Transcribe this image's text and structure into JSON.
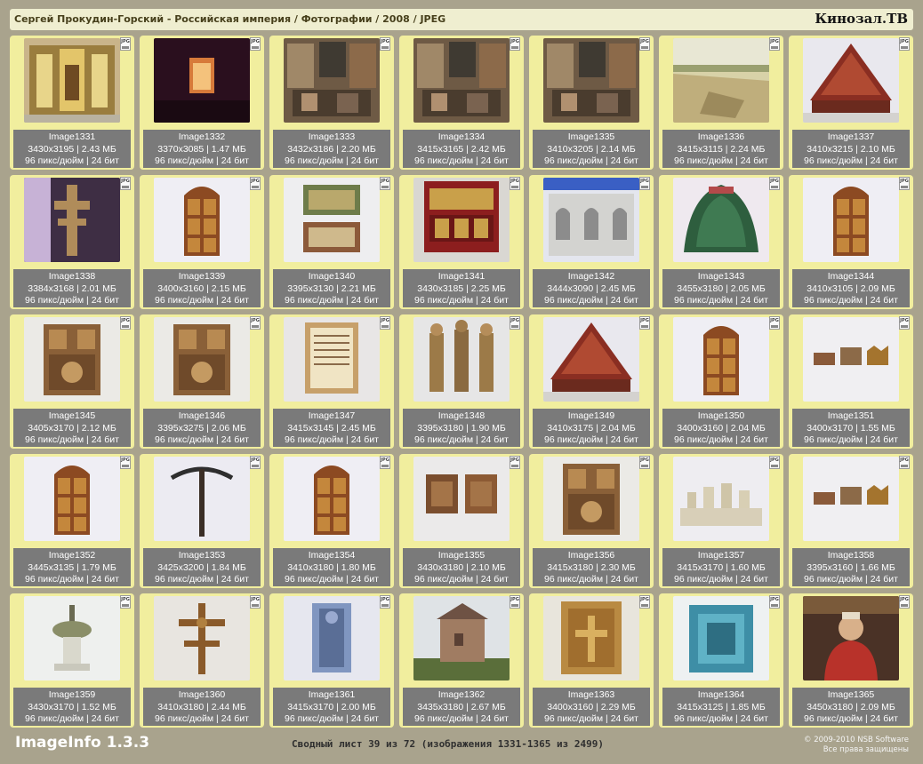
{
  "header": {
    "path_title": "Сергей Прокудин-Горский - Российская империя / Фотографии / 2008 / JPEG",
    "site_name": "Кинозал.ТВ"
  },
  "file_badge": "JPG",
  "images": [
    {
      "name": "Image1331",
      "size": "3430x3195 | 2.43 МБ",
      "meta": "96 пикс/дюйм | 24 бит",
      "scene": "iconostasis"
    },
    {
      "name": "Image1332",
      "size": "3370x3085 | 1.47 МБ",
      "meta": "96 пикс/дюйм | 24 бит",
      "scene": "dark-door"
    },
    {
      "name": "Image1333",
      "size": "3432x3186 | 2.20 МБ",
      "meta": "96 пикс/дюйм | 24 бит",
      "scene": "interior"
    },
    {
      "name": "Image1334",
      "size": "3415x3165 | 2.42 МБ",
      "meta": "96 пикс/дюйм | 24 бит",
      "scene": "interior"
    },
    {
      "name": "Image1335",
      "size": "3410x3205 | 2.14 МБ",
      "meta": "96 пикс/дюйм | 24 бит",
      "scene": "interior"
    },
    {
      "name": "Image1336",
      "size": "3415x3115 | 2.24 МБ",
      "meta": "96 пикс/дюйм | 24 бит",
      "scene": "landscape"
    },
    {
      "name": "Image1337",
      "size": "3410x3215 | 2.10 МБ",
      "meta": "96 пикс/дюйм | 24 бит",
      "scene": "vestment"
    },
    {
      "name": "Image1338",
      "size": "3384x3168 | 2.01 МБ",
      "meta": "96 пикс/дюйм | 24 бит",
      "scene": "cross"
    },
    {
      "name": "Image1339",
      "size": "3400x3160 | 2.15 МБ",
      "meta": "96 пикс/дюйм | 24 бит",
      "scene": "door"
    },
    {
      "name": "Image1340",
      "size": "3395x3130 | 2.21 МБ",
      "meta": "96 пикс/дюйм | 24 бит",
      "scene": "panels"
    },
    {
      "name": "Image1341",
      "size": "3430x3185 | 2.25 МБ",
      "meta": "96 пикс/дюйм | 24 бит",
      "scene": "red-cabinet"
    },
    {
      "name": "Image1342",
      "size": "3444x3090 | 2.45 МБ",
      "meta": "96 пикс/дюйм | 24 бит",
      "scene": "church"
    },
    {
      "name": "Image1343",
      "size": "3455x3180 | 2.05 МБ",
      "meta": "96 пикс/дюйм | 24 бит",
      "scene": "green-cloak"
    },
    {
      "name": "Image1344",
      "size": "3410x3105 | 2.09 МБ",
      "meta": "96 пикс/дюйм | 24 бит",
      "scene": "door"
    },
    {
      "name": "Image1345",
      "size": "3405x3170 | 2.12 МБ",
      "meta": "96 пикс/дюйм | 24 бит",
      "scene": "carving"
    },
    {
      "name": "Image1346",
      "size": "3395x3275 | 2.06 МБ",
      "meta": "96 пикс/дюйм | 24 бит",
      "scene": "carving"
    },
    {
      "name": "Image1347",
      "size": "3415x3145 | 2.45 МБ",
      "meta": "96 пикс/дюйм | 24 бит",
      "scene": "document"
    },
    {
      "name": "Image1348",
      "size": "3395x3180 | 1.90 МБ",
      "meta": "96 пикс/дюйм | 24 бит",
      "scene": "statues"
    },
    {
      "name": "Image1349",
      "size": "3410x3175 | 2.04 МБ",
      "meta": "96 пикс/дюйм | 24 бит",
      "scene": "vestment"
    },
    {
      "name": "Image1350",
      "size": "3400x3160 | 2.04 МБ",
      "meta": "96 пикс/дюйм | 24 бит",
      "scene": "door"
    },
    {
      "name": "Image1351",
      "size": "3400x3170 | 1.55 МБ",
      "meta": "96 пикс/дюйм | 24 бит",
      "scene": "crowns"
    },
    {
      "name": "Image1352",
      "size": "3445x3135 | 1.79 МБ",
      "meta": "96 пикс/дюйм | 24 бит",
      "scene": "door"
    },
    {
      "name": "Image1353",
      "size": "3425x3200 | 1.84 МБ",
      "meta": "96 пикс/дюйм | 24 бит",
      "scene": "staff"
    },
    {
      "name": "Image1354",
      "size": "3410x3180 | 1.80 МБ",
      "meta": "96 пикс/дюйм | 24 бит",
      "scene": "door"
    },
    {
      "name": "Image1355",
      "size": "3430x3180 | 2.10 МБ",
      "meta": "96 пикс/дюйм | 24 бит",
      "scene": "two-panels"
    },
    {
      "name": "Image1356",
      "size": "3415x3180 | 2.30 МБ",
      "meta": "96 пикс/дюйм | 24 бит",
      "scene": "carving"
    },
    {
      "name": "Image1357",
      "size": "3415x3170 | 1.60 МБ",
      "meta": "96 пикс/дюйм | 24 бит",
      "scene": "vessels"
    },
    {
      "name": "Image1358",
      "size": "3395x3160 | 1.66 МБ",
      "meta": "96 пикс/дюйм | 24 бит",
      "scene": "crowns"
    },
    {
      "name": "Image1359",
      "size": "3430x3170 | 1.52 МБ",
      "meta": "96 пикс/дюйм | 24 бит",
      "scene": "font"
    },
    {
      "name": "Image1360",
      "size": "3410x3180 | 2.44 МБ",
      "meta": "96 пикс/дюйм | 24 бит",
      "scene": "ornate-cross"
    },
    {
      "name": "Image1361",
      "size": "3415x3170 | 2.00 МБ",
      "meta": "96 пикс/дюйм | 24 бит",
      "scene": "figure-panel"
    },
    {
      "name": "Image1362",
      "size": "3435x3180 | 2.67 МБ",
      "meta": "96 пикс/дюйм | 24 бит",
      "scene": "building"
    },
    {
      "name": "Image1363",
      "size": "3400x3160 | 2.29 МБ",
      "meta": "96 пикс/дюйм | 24 бит",
      "scene": "gold-cover"
    },
    {
      "name": "Image1364",
      "size": "3415x3125 | 1.85 МБ",
      "meta": "96 пикс/дюйм | 24 бит",
      "scene": "blue-frame"
    },
    {
      "name": "Image1365",
      "size": "3450x3180 | 2.09 МБ",
      "meta": "96 пикс/дюйм | 24 бит",
      "scene": "portrait"
    }
  ],
  "footer": {
    "app_name": "ImageInfo 1.3.3",
    "sheet_info": "Сводный лист 39 из 72 (изображения 1331-1365 из 2499)",
    "copyright": "© 2009-2010 NSB Software",
    "rights": "Все права защищены"
  }
}
